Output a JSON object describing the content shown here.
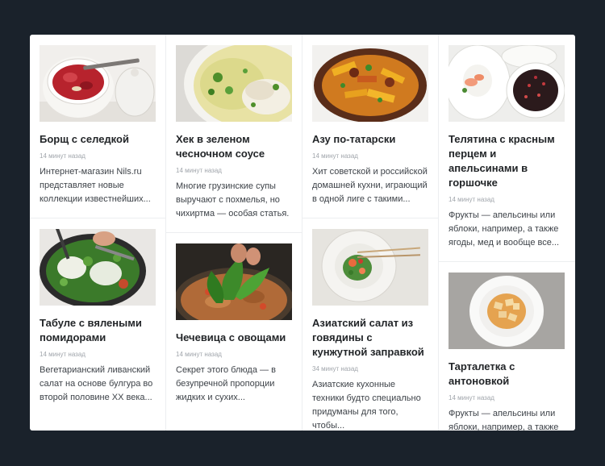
{
  "columns": [
    {
      "cards": [
        {
          "title": "Борщ с селедкой",
          "time": "14 минут назад",
          "desc": "Интернет-магазин Nils.ru представляет новые коллекции известнейших...",
          "image_icon": "borscht-bowl-icon"
        },
        {
          "title": "Табуле с вялеными помидорами",
          "time": "14 минут назад",
          "desc": "Вегетарианский ливанский салат на основе булгура во второй половине ХХ века...",
          "image_icon": "tabbouleh-pan-icon"
        }
      ]
    },
    {
      "cards": [
        {
          "title": "Хек в зеленом чесночном соусе",
          "time": "14 минут назад",
          "desc": "Многие грузинские супы выручают с похмелья, но чихиртма — особая статья.",
          "image_icon": "fish-soup-icon"
        },
        {
          "title": "Чечевица с овощами",
          "time": "14 минут назад",
          "desc": "Секрет этого блюда — в безупречной пропорции жидких и сухих...",
          "image_icon": "lentil-pan-icon"
        }
      ]
    },
    {
      "cards": [
        {
          "title": "Азу по-татарски",
          "time": "14 минут назад",
          "desc": "Хит советской и российской домашней кухни, играющий в одной лиге с такими...",
          "image_icon": "azu-stew-icon"
        },
        {
          "title": "Азиатский салат из говядины с кунжутной заправкой",
          "time": "34 минут назад",
          "desc": "Азиатские кухонные техники будто специально придуманы для того, чтобы...",
          "image_icon": "asian-salad-icon"
        }
      ]
    },
    {
      "cards": [
        {
          "title": "Телятина с красным перцем и апельсинами в горшочке",
          "time": "14 минут назад",
          "desc": "Фрукты — апельсины или яблоки, например, а также ягоды, мед и вообще все...",
          "image_icon": "veal-pot-icon"
        },
        {
          "title": "Тарталетка с антоновкой",
          "time": "14 минут назад",
          "desc": "Фрукты — апельсины или яблоки, например, а также ягоды, мед и вообще все...",
          "image_icon": "tart-plate-icon"
        }
      ]
    }
  ]
}
